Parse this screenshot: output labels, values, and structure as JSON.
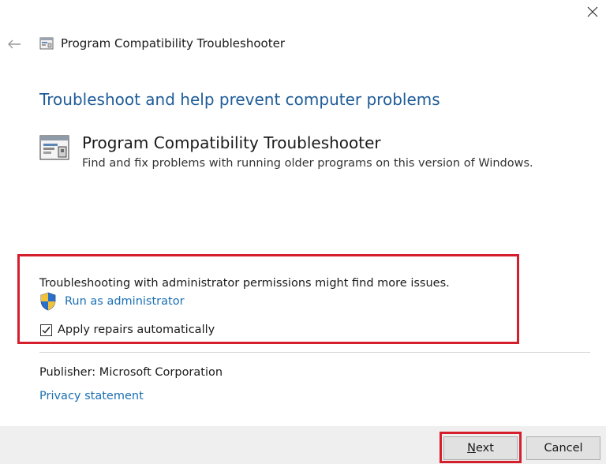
{
  "window": {
    "title": "Program Compatibility Troubleshooter",
    "close_label": "✕"
  },
  "main": {
    "heading": "Troubleshoot and help prevent computer problems",
    "troubleshooter": {
      "name": "Program Compatibility Troubleshooter",
      "description": "Find and fix problems with running older programs on this version of Windows."
    },
    "admin": {
      "note": "Troubleshooting with administrator permissions might find more issues.",
      "run_as_admin": "Run as administrator"
    },
    "repairs": {
      "label": "Apply repairs automatically",
      "checked": true
    },
    "publisher": "Publisher:  Microsoft Corporation",
    "privacy": "Privacy statement"
  },
  "footer": {
    "next_label": "Next",
    "cancel_label": "Cancel"
  },
  "colors": {
    "heading": "#1f5c99",
    "link": "#1a6fb3",
    "highlight": "#d61f2c"
  },
  "icons": {
    "back": "back-arrow-icon",
    "close": "close-icon",
    "app": "troubleshooter-icon",
    "shield": "uac-shield-icon"
  }
}
